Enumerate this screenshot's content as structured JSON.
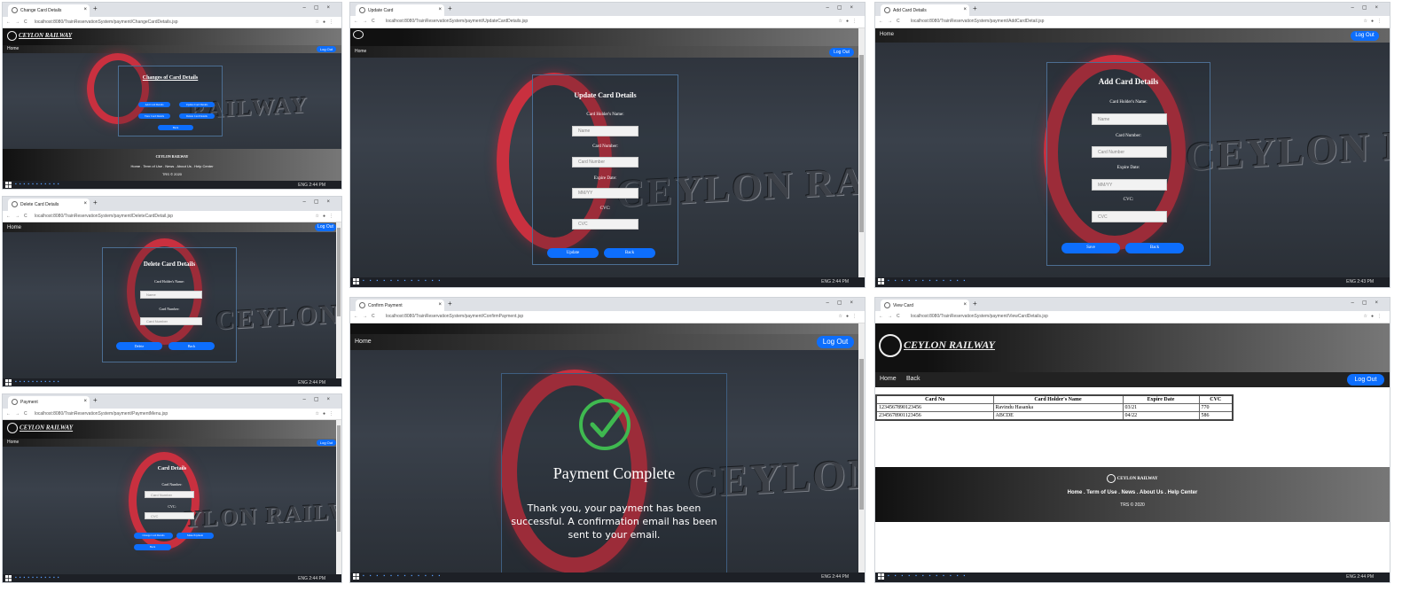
{
  "taskbar": {
    "lang": "ENG",
    "time_a": "2:44 PM",
    "time_b": "2:43 PM",
    "time_s": "2:44 PM"
  },
  "windows": {
    "change": {
      "tab": "Change Card Details",
      "url": "localhost:8080/TrainReservationSystem/payment/ChangeCardDetails.jsp",
      "nav_home": "Home",
      "logout": "Log Out",
      "logo": "CEYLON RAILWAY",
      "title": "Changes of Card Details",
      "buttons": [
        "Add Card Details",
        "Update Card Details",
        "View Card Details",
        "Delete Card Details"
      ],
      "back": "Back",
      "footer_logo": "CEYLON RAILWAY",
      "footer_links": "Home . Term of Use . News . About Us . Help Center",
      "footer_copy": "TRS © 2020",
      "brand": "RAILWAY"
    },
    "delete": {
      "tab": "Delete Card Details",
      "url": "localhost:8080/TrainReservationSystem/payment/DeleteCardDetail.jsp",
      "nav_home": "Home",
      "logout": "Log Out",
      "title": "Delete Card Details",
      "l_name": "Card Holder's Name:",
      "p_name": "Name",
      "l_number": "Card Number:",
      "p_number": "Card Number",
      "delete": "Delete",
      "back": "Back",
      "brand": "CEYLON R"
    },
    "payment": {
      "tab": "Payment",
      "url": "localhost:8080/TrainReservationSystem/payment/PaymentMenu.jsp",
      "logo": "CEYLON RAILWAY",
      "nav_home": "Home",
      "logout": "Log Out",
      "title": "Card Details",
      "l_number": "Card Number:",
      "p_number": "Card Number",
      "l_cvc": "CVC:",
      "p_cvc": "CVC",
      "change": "Change Card Details",
      "make": "Make Payment",
      "back": "Back",
      "brand": "YLON RAILWAY"
    },
    "update": {
      "tab": "Update Card",
      "url": "localhost:8080/TrainReservationSystem/payment/UpdateCardDetails.jsp",
      "nav_home": "Home",
      "logout": "Log Out",
      "title": "Update Card Details",
      "l_name": "Card Holder's Name:",
      "p_name": "Name",
      "l_number": "Card Number:",
      "p_number": "Card Number",
      "l_exp": "Expire Date:",
      "p_exp": "MM/YY",
      "l_cvc": "CVC:",
      "p_cvc": "CVC",
      "update": "Update",
      "back": "Back",
      "brand": "CEYLON RAILWAY"
    },
    "confirm": {
      "tab": "Confirm Payment",
      "url": "localhost:8080/TrainReservationSystem/payment/ConfirmPayment.jsp",
      "nav_home": "Home",
      "logout": "Log Out",
      "title": "Payment Complete",
      "message": "Thank you, your payment has been successful. A confirmation email has been sent to your email.",
      "brand": "CEYLON RA"
    },
    "add": {
      "tab": "Add Card Details",
      "url": "localhost:8080/TrainReservationSystem/payment/AddCardDetail.jsp",
      "nav_home": "Home",
      "logout": "Log Out",
      "title": "Add Card Details",
      "l_name": "Card Holder's Name:",
      "p_name": "Name",
      "l_number": "Card Number:",
      "p_number": "Card Number",
      "l_exp": "Expire Date:",
      "p_exp": "MM/YY",
      "l_cvc": "CVC:",
      "p_cvc": "CVC",
      "save": "Save",
      "back": "Back",
      "brand": "CEYLON RAI"
    },
    "view": {
      "tab": "View Card",
      "url": "localhost:8080/TrainReservationSystem/payment/ViewCardDetails.jsp",
      "logo": "CEYLON RAILWAY",
      "nav_home": "Home",
      "nav_back": "Back",
      "logout": "Log Out",
      "headers": [
        "Card No",
        "Card Holder's Name",
        "Expire Date",
        "CVC"
      ],
      "rows": [
        [
          "1234567890123456",
          "Ravindu Hasanka",
          "03/21",
          "770"
        ],
        [
          "2345678901123456",
          "ABCDE",
          "04/22",
          "586"
        ]
      ],
      "footer_logo": "CEYLON RAILWAY",
      "footer_links": "Home . Term of Use . News . About Us . Help Center",
      "footer_copy": "TRS © 2020"
    }
  }
}
